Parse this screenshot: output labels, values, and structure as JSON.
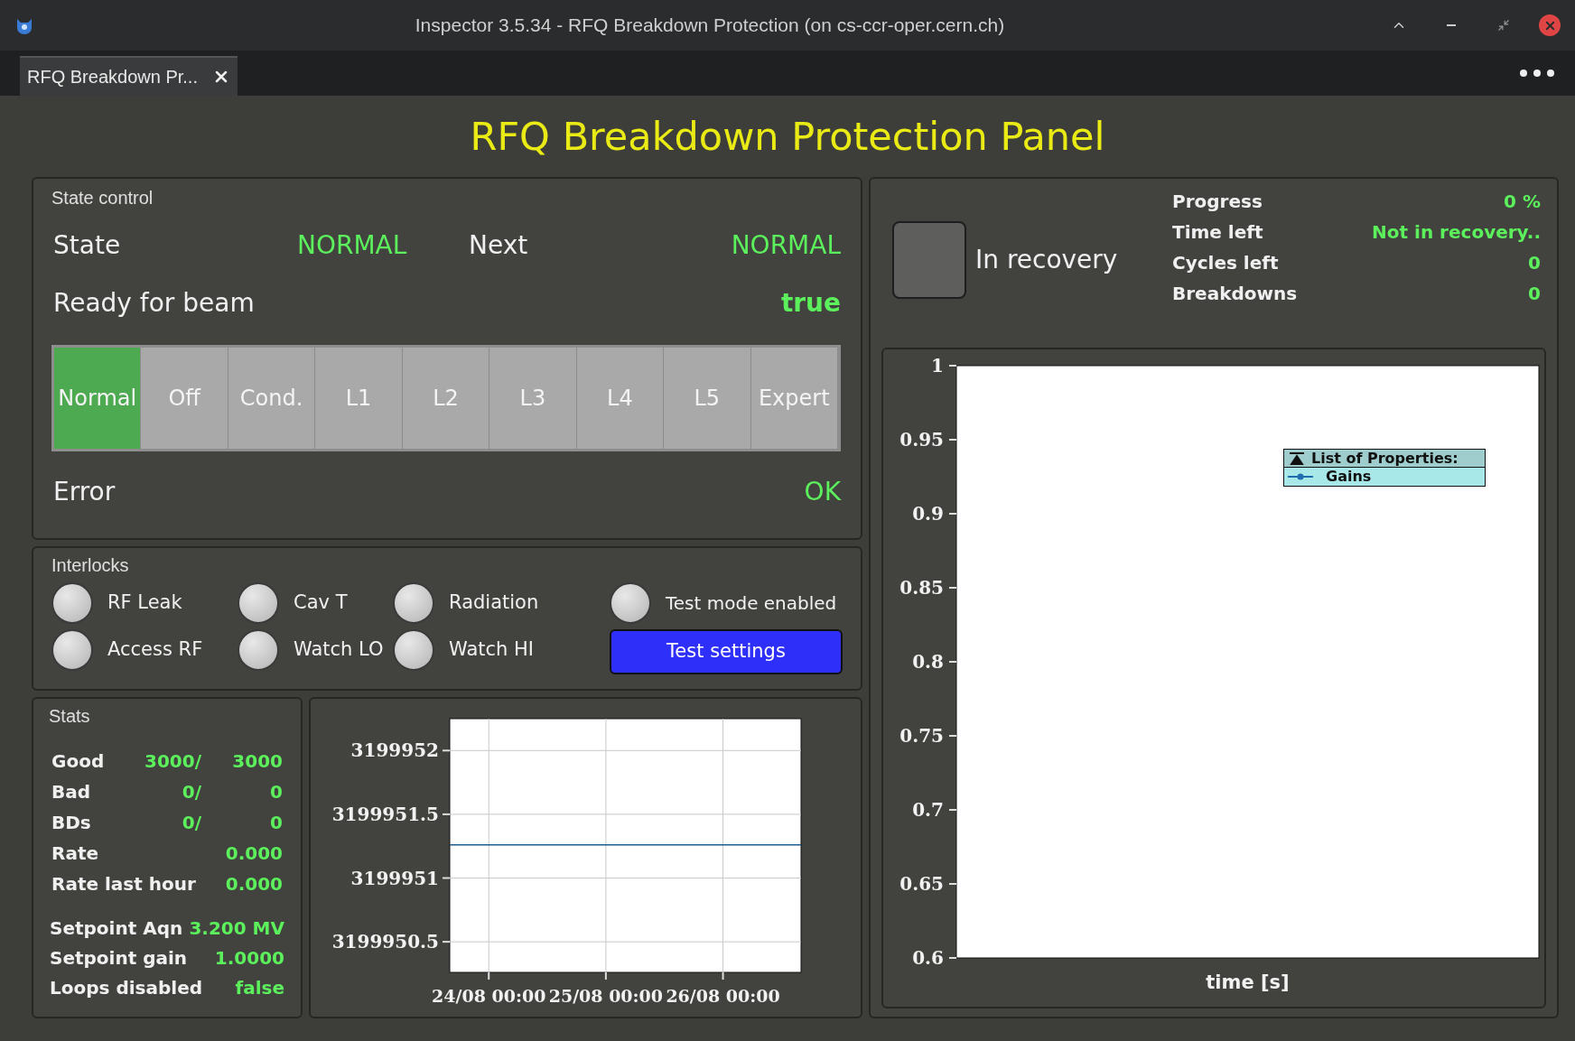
{
  "window": {
    "title": "Inspector 3.5.34 - RFQ Breakdown Protection (on cs-ccr-oper.cern.ch)"
  },
  "tabs": [
    {
      "label": "RFQ Breakdown Pr...",
      "selected": true
    }
  ],
  "panel_title": "RFQ Breakdown Protection Panel",
  "state_control": {
    "title": "State control",
    "state_label": "State",
    "state_value": "NORMAL",
    "next_label": "Next",
    "next_value": "NORMAL",
    "ready_label": "Ready for beam",
    "ready_value": "true",
    "error_label": "Error",
    "error_value": "OK",
    "modes": [
      {
        "label": "Normal",
        "selected": true
      },
      {
        "label": "Off",
        "selected": false
      },
      {
        "label": "Cond.",
        "selected": false
      },
      {
        "label": "L1",
        "selected": false
      },
      {
        "label": "L2",
        "selected": false
      },
      {
        "label": "L3",
        "selected": false
      },
      {
        "label": "L4",
        "selected": false
      },
      {
        "label": "L5",
        "selected": false
      },
      {
        "label": "Expert",
        "selected": false
      }
    ]
  },
  "interlocks": {
    "title": "Interlocks",
    "columns": [
      [
        {
          "label": "RF Leak",
          "on": false
        },
        {
          "label": "Access RF",
          "on": false
        }
      ],
      [
        {
          "label": "Cav T",
          "on": false
        },
        {
          "label": "Watch LO",
          "on": false
        }
      ],
      [
        {
          "label": "Radiation",
          "on": false
        },
        {
          "label": "Watch HI",
          "on": false
        }
      ]
    ],
    "test_mode": {
      "label": "Test mode enabled",
      "on": false
    },
    "button": "Test settings"
  },
  "stats": {
    "title": "Stats",
    "counters": [
      {
        "label": "Good",
        "value": "3000/",
        "total": "3000"
      },
      {
        "label": "Bad",
        "value": "0/",
        "total": "0"
      },
      {
        "label": "BDs",
        "value": "0/",
        "total": "0"
      },
      {
        "label": "Rate",
        "value": "0.000"
      },
      {
        "label": "Rate last hour",
        "value": "0.000"
      }
    ],
    "settings": [
      {
        "label": "Setpoint Aqn",
        "value": "3.200 MV"
      },
      {
        "label": "Setpoint gain",
        "value": "1.0000"
      },
      {
        "label": "Loops disabled",
        "value": "false"
      }
    ]
  },
  "history_chart": {
    "chart_data": {
      "type": "line",
      "categories": [
        null,
        "24/08 00:00",
        null,
        null,
        "25/08 00:00",
        null,
        null,
        "26/08 00:00",
        null,
        null
      ],
      "series": [
        {
          "color": "#1f5f8f",
          "values": [
            3199951.26,
            3199951.26,
            3199951.26,
            3199951.26,
            3199951.26,
            3199951.26,
            3199951.26,
            3199951.26,
            3199951.26,
            3199951.26
          ]
        }
      ],
      "ylim": [
        3199950.26,
        3199952.25
      ],
      "grid": true,
      "yticks": [
        {
          "value": 3199952,
          "label": "3199952"
        },
        {
          "value": 3199951.5,
          "label": "3199951.5"
        },
        {
          "value": 3199951,
          "label": "3199951"
        },
        {
          "value": 3199950.5,
          "label": "3199950.5"
        }
      ]
    }
  },
  "recovery": {
    "label": "In recovery",
    "on": false,
    "info": [
      {
        "label": "Progress",
        "value": "0 %"
      },
      {
        "label": "Time left",
        "value": "Not in recovery.."
      },
      {
        "label": "Cycles left",
        "value": "0"
      },
      {
        "label": "Breakdowns",
        "value": "0"
      }
    ]
  },
  "gains_chart": {
    "legend_title": "List of Properties:",
    "legend_item": {
      "name": "Gains",
      "color": "#1f6fb0"
    },
    "xlabel": "time [s]",
    "y_labels": [
      "1",
      "0.95",
      "0.9",
      "0.85",
      "0.8",
      "0.75",
      "0.7",
      "0.65",
      "0.6"
    ]
  }
}
